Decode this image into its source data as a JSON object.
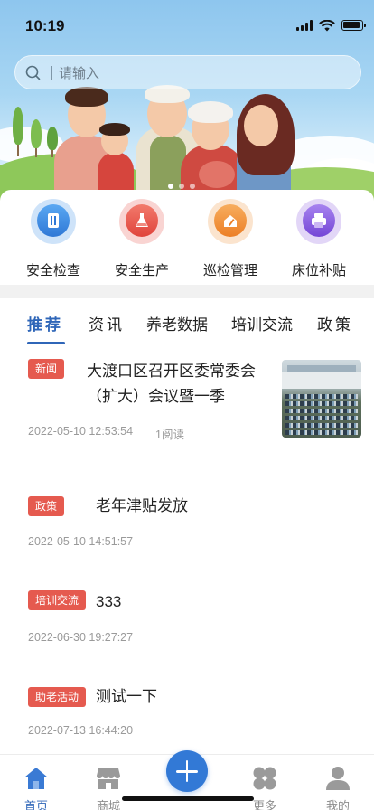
{
  "status_bar": {
    "time": "10:19"
  },
  "search": {
    "placeholder": "请输入"
  },
  "banner": {
    "slide_count": 3,
    "active_slide": 1
  },
  "quick_menu": [
    {
      "label": "安全检查",
      "icon": "document-icon",
      "color": "#3a8ee6"
    },
    {
      "label": "安全生产",
      "icon": "flask-icon",
      "color": "#e8544d"
    },
    {
      "label": "巡检管理",
      "icon": "pencil-house-icon",
      "color": "#f0923a"
    },
    {
      "label": "床位补贴",
      "icon": "printer-icon",
      "color": "#8a5ce0"
    }
  ],
  "tabs": [
    {
      "label": "推荐",
      "active": true
    },
    {
      "label": "资讯"
    },
    {
      "label": "养老数据"
    },
    {
      "label": "培训交流"
    },
    {
      "label": "政策"
    }
  ],
  "news": [
    {
      "tag": "新闻",
      "title": "大渡口区召开区委常委会（扩大）会议暨一季",
      "time": "2022-05-10 12:53:54",
      "reads": "1阅读",
      "has_thumbnail": true
    },
    {
      "tag": "政策",
      "title": "老年津贴发放",
      "time": "2022-05-10 14:51:57"
    },
    {
      "tag": "培训交流",
      "title": "333",
      "time": "2022-06-30 19:27:27"
    },
    {
      "tag": "助老活动",
      "title": "测试一下",
      "time": "2022-07-13 16:44:20"
    }
  ],
  "tab_bar": [
    {
      "label": "首页",
      "icon": "home-icon",
      "active": true
    },
    {
      "label": "商城",
      "icon": "shop-icon"
    },
    {
      "label": "",
      "icon": "plus-icon"
    },
    {
      "label": "更多",
      "icon": "clover-icon"
    },
    {
      "label": "我的",
      "icon": "user-icon"
    }
  ],
  "colors": {
    "accent": "#2f66b8",
    "tag_red": "#e55a4f",
    "fab": "#3279d6"
  }
}
